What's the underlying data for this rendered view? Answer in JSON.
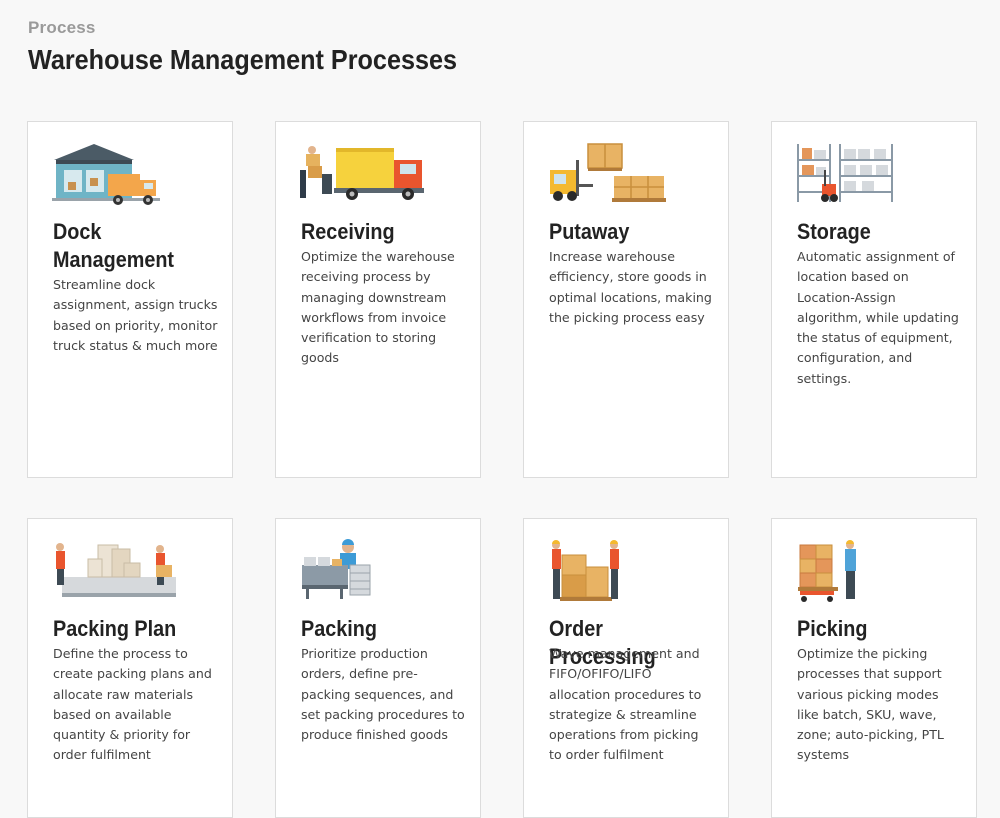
{
  "header": {
    "eyebrow": "Process",
    "title": "Warehouse Management Processes"
  },
  "cards": [
    {
      "title": "Dock Management",
      "description": "Streamline dock assignment, assign trucks based on priority, monitor truck status & much more",
      "icon": "dock-truck-illustration"
    },
    {
      "title": "Receiving",
      "description": "Optimize the warehouse receiving process by managing downstream workflows from invoice verification to storing goods",
      "icon": "delivery-truck-illustration"
    },
    {
      "title": "Putaway",
      "description": "Increase warehouse efficiency, store goods in optimal locations, making the picking process easy",
      "icon": "forklift-pallets-illustration"
    },
    {
      "title": "Storage",
      "description": "Automatic assignment of location based on Location-Assign algorithm, while updating the status of equipment, configuration, and settings.",
      "icon": "storage-racks-illustration"
    },
    {
      "title": "Packing Plan",
      "description": "Define the process to create packing plans and allocate raw materials based on available quantity & priority for order fulfilment",
      "icon": "workers-conveyor-illustration"
    },
    {
      "title": "Packing",
      "description": "Prioritize production orders, define pre-packing sequences, and set packing procedures to produce finished goods",
      "icon": "packing-worker-illustration"
    },
    {
      "title": "Order Processing",
      "description": "Wave management and FIFO/OFIFO/LIFO allocation procedures to strategize & streamline operations from picking to order fulfilment",
      "icon": "workers-boxes-illustration"
    },
    {
      "title": "Picking",
      "description": "Optimize the picking processes that support various picking modes like batch, SKU, wave, zone; auto-picking, PTL systems",
      "icon": "picking-worker-illustration"
    }
  ]
}
